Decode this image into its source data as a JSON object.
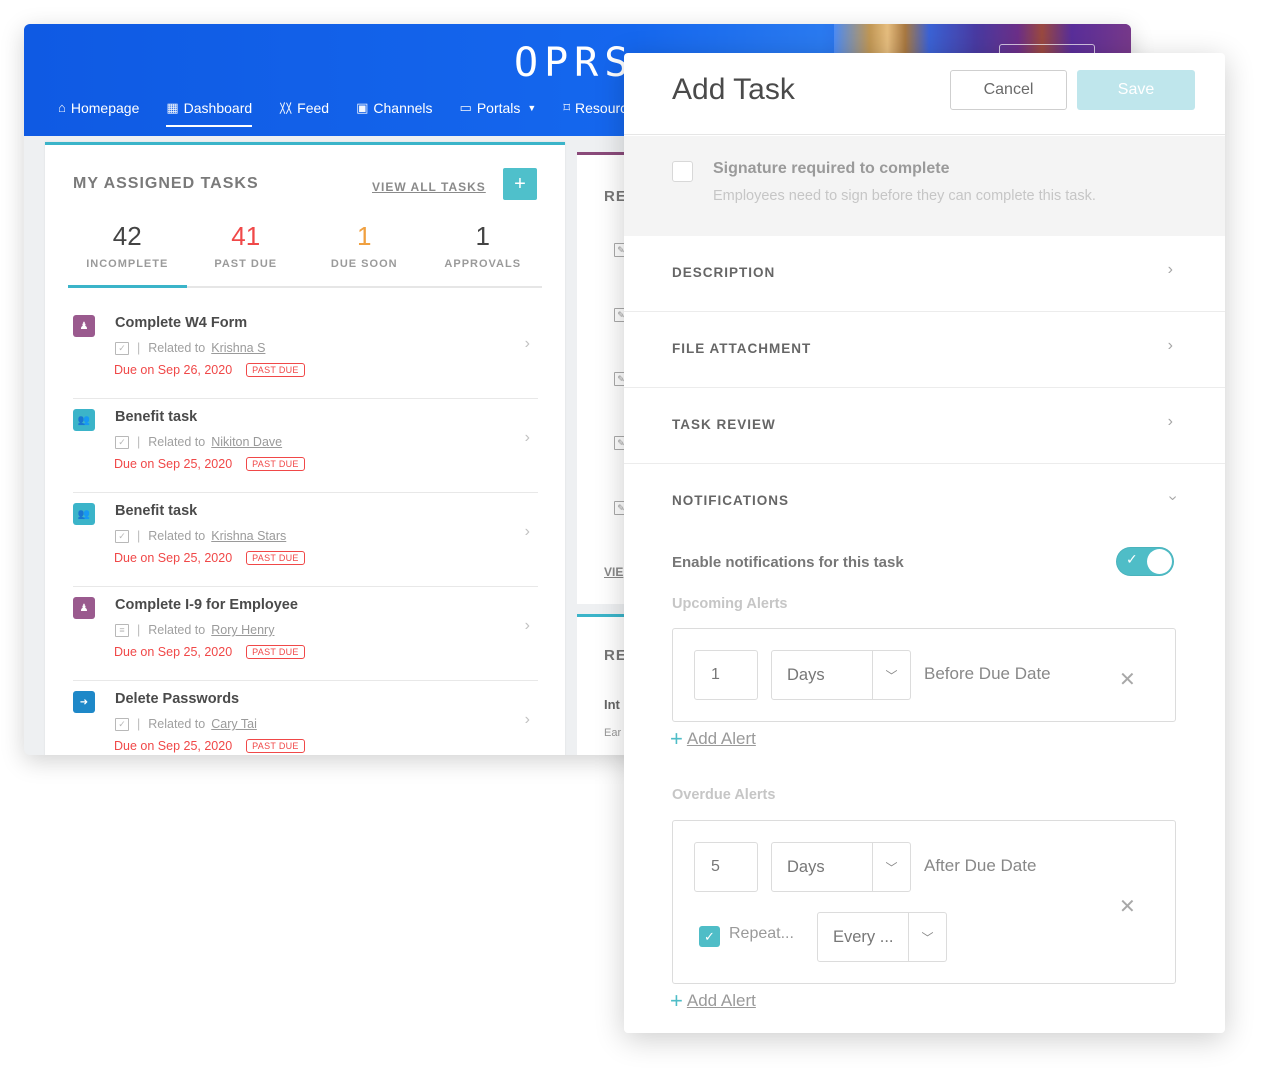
{
  "dashboard": {
    "logo": "OPRS",
    "nav": [
      {
        "label": "Homepage",
        "icon": "home-icon",
        "glyph": "⌂",
        "active": false
      },
      {
        "label": "Dashboard",
        "icon": "grid-icon",
        "glyph": "▦",
        "active": true
      },
      {
        "label": "Feed",
        "icon": "rss-icon",
        "glyph": "〷",
        "active": false
      },
      {
        "label": "Channels",
        "icon": "tv-icon",
        "glyph": "▣",
        "active": false
      },
      {
        "label": "Portals",
        "icon": "window-icon",
        "glyph": "▭",
        "active": false,
        "dropdown": true
      },
      {
        "label": "Resource",
        "icon": "bookmark-icon",
        "glyph": "⌑",
        "active": false
      }
    ],
    "tasks_card": {
      "title": "MY ASSIGNED TASKS",
      "view_all": "VIEW ALL TASKS",
      "add_glyph": "+",
      "stats": [
        {
          "value": "42",
          "label": "INCOMPLETE",
          "color": "#444444",
          "active": true
        },
        {
          "value": "41",
          "label": "PAST DUE",
          "color": "#f04848",
          "active": false
        },
        {
          "value": "1",
          "label": "DUE SOON",
          "color": "#f0a040",
          "active": false
        },
        {
          "value": "1",
          "label": "APPROVALS",
          "color": "#444444",
          "active": false
        }
      ],
      "tasks": [
        {
          "title": "Complete W4 Form",
          "type_icon": "checkbox-icon",
          "related_prefix": "Related to",
          "person": "Krishna S",
          "due": "Due on Sep 26, 2020",
          "badge": "PAST DUE",
          "avatar": "badge-icon",
          "avatar_color": "#9a5a8e"
        },
        {
          "title": "Benefit task",
          "type_icon": "checkbox-icon",
          "related_prefix": "Related to",
          "person": "Nikiton Dave",
          "due": "Due on Sep 25, 2020",
          "badge": "PAST DUE",
          "avatar": "team-icon",
          "avatar_color": "#3bb4c9"
        },
        {
          "title": "Benefit task",
          "type_icon": "checkbox-icon",
          "related_prefix": "Related to",
          "person": "Krishna Stars",
          "due": "Due on Sep 25, 2020",
          "badge": "PAST DUE",
          "avatar": "team-icon",
          "avatar_color": "#3bb4c9"
        },
        {
          "title": "Complete I-9 for Employee",
          "type_icon": "form-icon",
          "related_prefix": "Related to",
          "person": "Rory Henry",
          "due": "Due on Sep 25, 2020",
          "badge": "PAST DUE",
          "avatar": "badge-icon",
          "avatar_color": "#9a5a8e"
        },
        {
          "title": "Delete Passwords",
          "type_icon": "checkbox-icon",
          "related_prefix": "Related to",
          "person": "Cary Tai",
          "due": "Due on Sep 25, 2020",
          "badge": "PAST DUE",
          "avatar": "door-exit-icon",
          "avatar_color": "#1e88c8"
        }
      ]
    },
    "mid_card": {
      "title": "RE",
      "link": "VIE"
    },
    "mid_card2": {
      "title": "RE",
      "sub": "Int",
      "sub2": "Ear"
    }
  },
  "panel": {
    "title": "Add Task",
    "cancel": "Cancel",
    "save": "Save",
    "signature": {
      "label": "Signature required to complete",
      "description": "Employees need to sign before they can complete this task.",
      "checked": false
    },
    "sections": [
      {
        "label": "DESCRIPTION",
        "expanded": false
      },
      {
        "label": "FILE ATTACHMENT",
        "expanded": false
      },
      {
        "label": "TASK REVIEW",
        "expanded": false
      },
      {
        "label": "NOTIFICATIONS",
        "expanded": true
      }
    ],
    "notifications": {
      "enable_label": "Enable notifications for this task",
      "enabled": true,
      "upcoming": {
        "label": "Upcoming Alerts",
        "amount": "1",
        "unit": "Days",
        "trail": "Before Due Date",
        "add": "Add Alert"
      },
      "overdue": {
        "label": "Overdue Alerts",
        "amount": "5",
        "unit": "Days",
        "trail": "After Due Date",
        "repeat_label": "Repeat...",
        "repeat_checked": true,
        "repeat_value": "Every ...",
        "add": "Add Alert"
      }
    }
  }
}
